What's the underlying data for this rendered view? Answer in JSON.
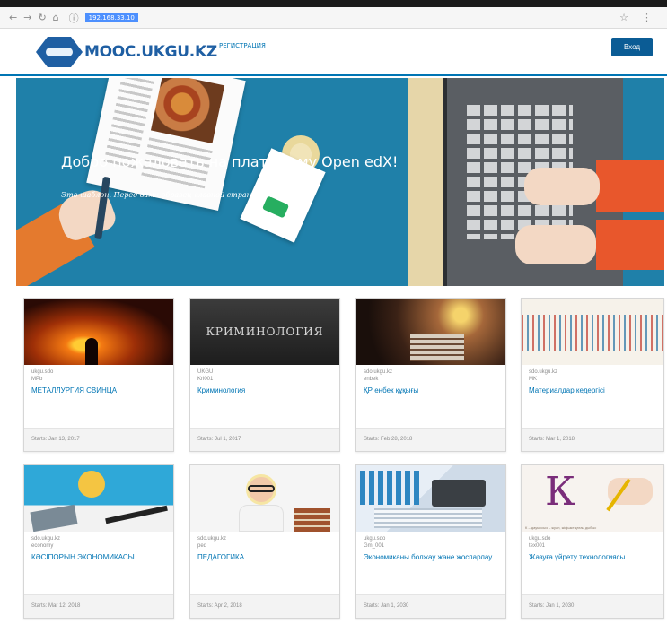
{
  "browser": {
    "back_icon": "←",
    "forward_icon": "→",
    "reload_icon": "↻",
    "home_icon": "⌂",
    "info_icon": "ⓘ",
    "url": "192.168.33.10",
    "star_icon": "☆",
    "menu_icon": "⋮"
  },
  "header": {
    "logo_text": "MOOC.UKGU.KZ",
    "register_link": "РЕГИСТРАЦИЯ",
    "signin_button": "Вход",
    "brand_color": "#1f5fa3"
  },
  "hero": {
    "title": "Добро пожаловать на платформу Open edX!",
    "subtitle": "Это шаблон. Перед вами образец главной страницы Open edX."
  },
  "courses": [
    {
      "org": "ukgu.sdo",
      "number": "MPb",
      "title": "МЕТАЛЛУРГИЯ СВИНЦА",
      "starts": "Starts: Jan 13, 2017",
      "thumb": "metal"
    },
    {
      "org": "UKGU",
      "number": "Kri001",
      "title": "Криминология",
      "starts": "Starts: Jul 1, 2017",
      "thumb": "crime",
      "thumb_text": "КРИМИНОЛОГИЯ"
    },
    {
      "org": "sdo.ukgu.kz",
      "number": "enbek",
      "title": "ҚР еңбек құқығы",
      "starts": "Starts: Feb 28, 2018",
      "thumb": "law"
    },
    {
      "org": "sdo.ukgu.kz",
      "number": "MK",
      "title": "Материалдар кедергісі",
      "starts": "Starts: Mar 1, 2018",
      "thumb": "mat"
    },
    {
      "org": "sdo.ukgu.kz",
      "number": "economy",
      "title": "КӘСІПОРЫН ЭКОНОМИКАСЫ",
      "starts": "Starts: Mar 12, 2018",
      "thumb": "kz"
    },
    {
      "org": "sdo.ukgu.kz",
      "number": "ped",
      "title": "ПЕДАГОГИКА",
      "starts": "Starts: Apr 2, 2018",
      "thumb": "child"
    },
    {
      "org": "ukgu.sdo",
      "number": "Gm_001",
      "title": "Экономиканы болжау және жоспарлау",
      "starts": "Starts: Jan 1, 2030",
      "thumb": "econ"
    },
    {
      "org": "ukgu.sdo",
      "number": "tex001",
      "title": "Жазуға үйрету технологиясы",
      "starts": "Starts: Jan 1, 2030",
      "thumb": "kletter",
      "thumb_caption": "К – дауыссыз – жуан, жіңішке қатаң дыбыс"
    }
  ]
}
